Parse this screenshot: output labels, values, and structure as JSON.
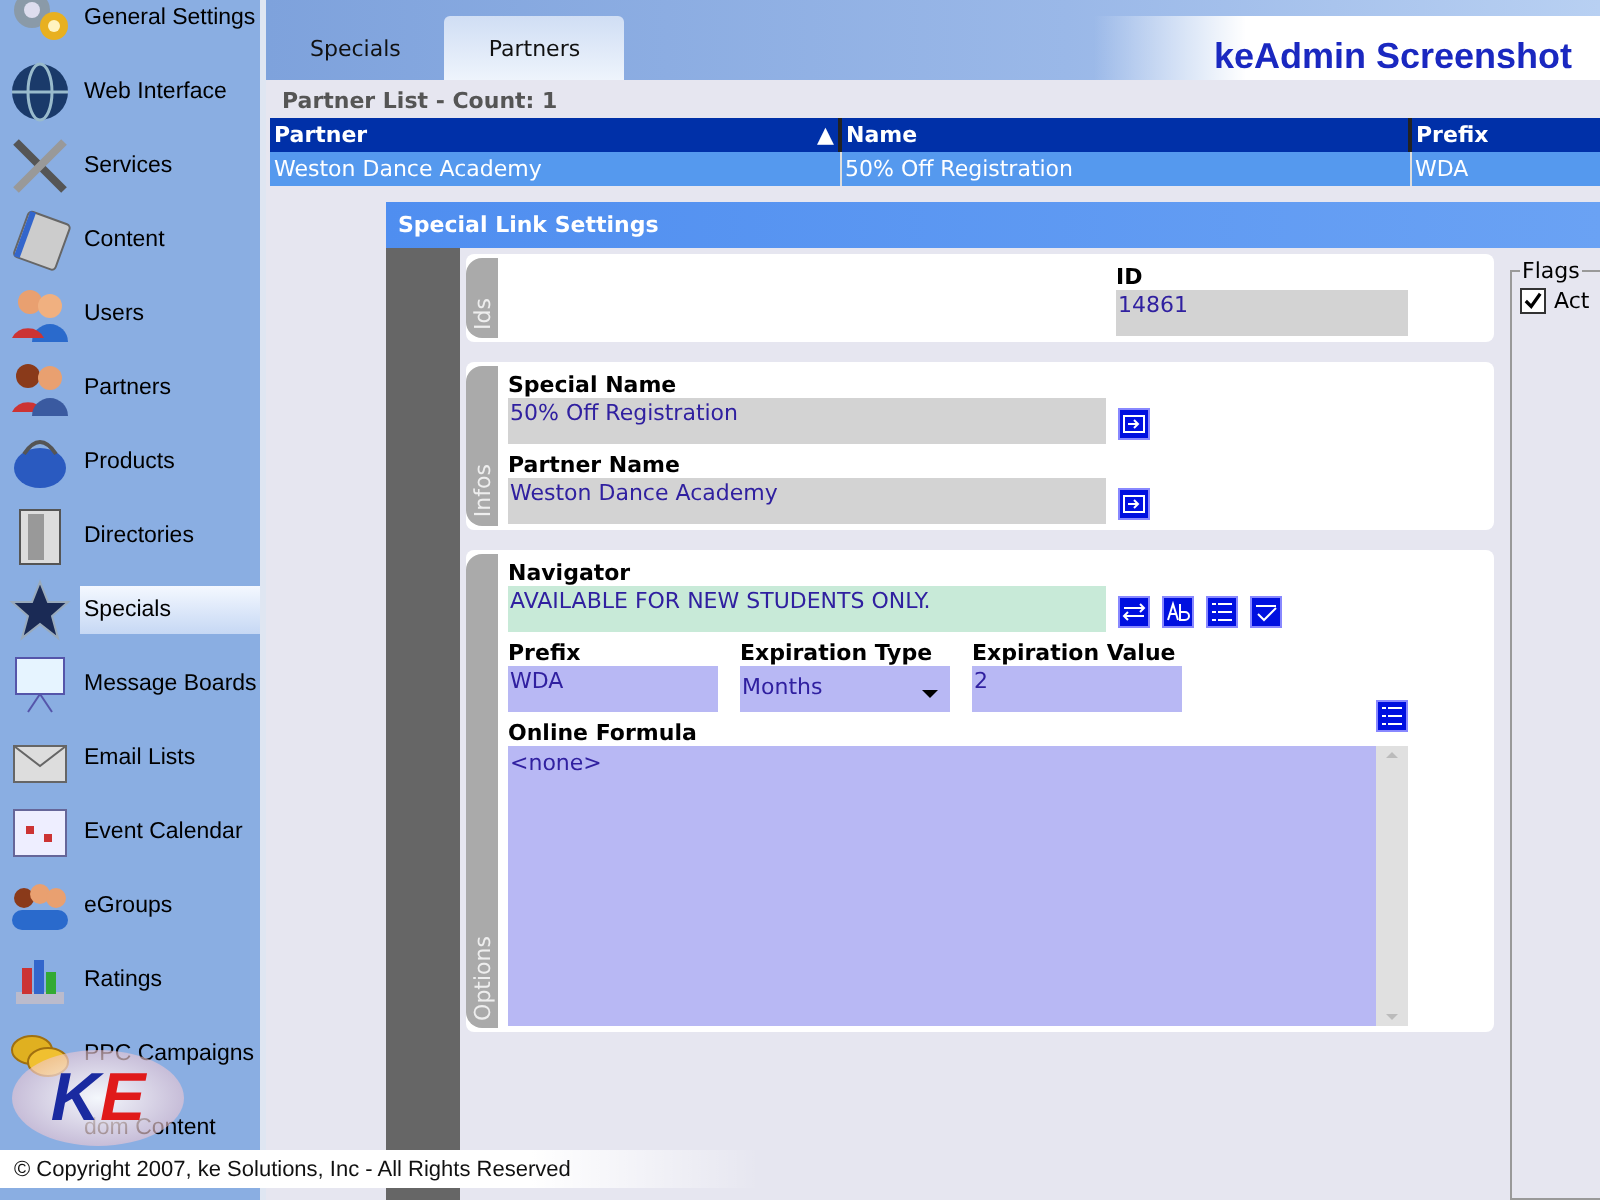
{
  "sidebar": {
    "items": [
      {
        "label": "General Settings",
        "selected": false
      },
      {
        "label": "Web Interface",
        "selected": false
      },
      {
        "label": "Services",
        "selected": false
      },
      {
        "label": "Content",
        "selected": false
      },
      {
        "label": "Users",
        "selected": false
      },
      {
        "label": "Partners",
        "selected": false
      },
      {
        "label": "Products",
        "selected": false
      },
      {
        "label": "Directories",
        "selected": false
      },
      {
        "label": "Specials",
        "selected": true
      },
      {
        "label": "Message Boards",
        "selected": false
      },
      {
        "label": "Email Lists",
        "selected": false
      },
      {
        "label": "Event Calendar",
        "selected": false
      },
      {
        "label": "eGroups",
        "selected": false
      },
      {
        "label": "Ratings",
        "selected": false
      },
      {
        "label": "PPC Campaigns",
        "selected": false
      },
      {
        "label": "dom Content",
        "selected": false
      }
    ]
  },
  "logo": {
    "parts": [
      "K",
      "E"
    ]
  },
  "tabs": [
    {
      "label": "Specials",
      "selected": false
    },
    {
      "label": "Partners",
      "selected": true
    }
  ],
  "app_title": "keAdmin Screenshot",
  "partner_list": {
    "caption": "Partner List - Count: 1",
    "columns": [
      {
        "label": "Partner",
        "sort_indicator": "▲"
      },
      {
        "label": "Name"
      },
      {
        "label": "Prefix"
      }
    ],
    "rows": [
      {
        "cells": [
          "Weston Dance Academy",
          "50% Off Registration",
          "WDA"
        ],
        "selected": true
      }
    ]
  },
  "dialog": {
    "title": "Special Link Settings",
    "sections": [
      {
        "tab": "Ids",
        "rows": [
          [
            {
              "label": "ID",
              "value": "14861",
              "kind": "readonly"
            }
          ]
        ]
      },
      {
        "tab": "Infos",
        "rows": [
          [
            {
              "label": "Special Name",
              "value": "50% Off Registration",
              "kind": "linked"
            }
          ],
          [
            {
              "label": "Partner Name",
              "value": "Weston Dance Academy",
              "kind": "linked"
            }
          ]
        ]
      },
      {
        "tab": "Options",
        "rows": [
          [
            {
              "label": "Navigator",
              "value": "AVAILABLE FOR NEW STUDENTS ONLY.",
              "kind": "rich"
            }
          ],
          [
            {
              "label": "Prefix",
              "value": "WDA",
              "kind": "input"
            },
            {
              "label": "Expiration Type",
              "value": "Months",
              "kind": "select"
            },
            {
              "label": "Expiration Value",
              "value": "2",
              "kind": "input"
            }
          ],
          [
            {
              "label": "Online Formula",
              "value": "<none>",
              "kind": "textarea"
            }
          ]
        ]
      }
    ],
    "flags": {
      "legend": "Flags",
      "items": [
        {
          "label": "Act",
          "checked": true
        }
      ]
    }
  },
  "copyright": "© Copyright 2007, ke Solutions, Inc - All Rights Reserved"
}
